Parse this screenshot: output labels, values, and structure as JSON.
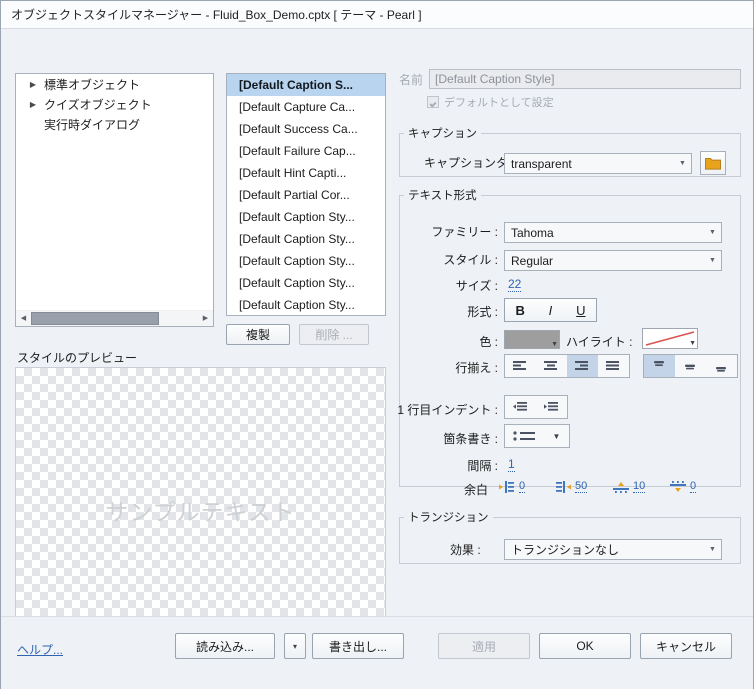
{
  "window": {
    "title": "オブジェクトスタイルマネージャー - Fluid_Box_Demo.cptx [ テーマ - Pearl ]"
  },
  "tree": {
    "items": [
      {
        "label": "標準オブジェクト",
        "expandable": true
      },
      {
        "label": "クイズオブジェクト",
        "expandable": true
      },
      {
        "label": "実行時ダイアログ",
        "expandable": false
      }
    ]
  },
  "style_list": {
    "items": [
      "[Default Caption S...",
      "[Default Capture Ca...",
      "[Default Success Ca...",
      "[Default Failure Cap...",
      "[Default Hint Capti...",
      "[Default Partial Cor...",
      "[Default Caption Sty...",
      "[Default Caption Sty...",
      "[Default Caption Sty...",
      "[Default Caption Sty...",
      "[Default Caption Sty..."
    ],
    "selected_index": 0
  },
  "list_buttons": {
    "duplicate": "複製",
    "delete": "削除 ..."
  },
  "preview": {
    "label": "スタイルのプレビュー",
    "sample_text": "サンプルテキスト",
    "text_color": "#cdd0d5"
  },
  "name": {
    "label": "名前",
    "value": "[Default Caption Style]",
    "set_as_default_label": "デフォルトとして設定",
    "set_as_default_checked": true
  },
  "caption": {
    "group_label": "キャプション",
    "type_label": "キャプションタイプ",
    "type_value": "transparent",
    "folder_icon": "folder-icon",
    "folder_color": "#e8a21c"
  },
  "text_format": {
    "group_label": "テキスト形式",
    "family_label": "ファミリー :",
    "family_value": "Tahoma",
    "style_label": "スタイル :",
    "style_value": "Regular",
    "size_label": "サイズ :",
    "size_value": "22",
    "format_label": "形式 :",
    "bold": "B",
    "italic": "I",
    "underline": "U",
    "color_label": "色 :",
    "color_value": "#9e9e9e",
    "highlight_label": "ハイライト :",
    "highlight_value": "none",
    "align_label": "行揃え :",
    "align_selected_index": 2,
    "valign_selected_index": 0,
    "indent_label": "1 行目インデント :",
    "bullets_label": "箇条書き :",
    "spacing_label": "間隔 :",
    "spacing_value": "1",
    "margin_label": "余白",
    "margins": [
      {
        "name": "margin-left",
        "value": "0"
      },
      {
        "name": "margin-right",
        "value": "50"
      },
      {
        "name": "margin-top",
        "value": "10"
      },
      {
        "name": "margin-bottom",
        "value": "0"
      }
    ],
    "link_color": "#2f64b0"
  },
  "transition": {
    "group_label": "トランジション",
    "effect_label": "効果 :",
    "effect_value": "トランジションなし"
  },
  "footer": {
    "help": "ヘルプ...",
    "import": "読み込み...",
    "import_dropdown": "▾",
    "export": "書き出し...",
    "apply": "適用",
    "apply_enabled": false,
    "ok": "OK",
    "cancel": "キャンセル"
  }
}
